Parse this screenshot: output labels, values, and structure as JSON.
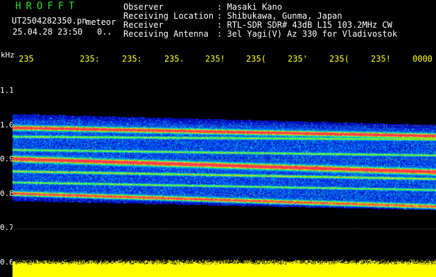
{
  "header": {
    "app_title": "HROFFT",
    "filename": "UT2504282350.pn",
    "type_label": "meteor",
    "datetime": "25.04.28 23:50",
    "dots": "0..",
    "info": [
      {
        "label": "Observer",
        "sep": ":",
        "value": "Masaki Kano"
      },
      {
        "label": "Receiving Location",
        "sep": ":",
        "value": "Shibukawa, Gunma, Japan"
      },
      {
        "label": "Receiver",
        "sep": ":",
        "value": "RTL-SDR SDR# 43dB L15 103.2MHz CW"
      },
      {
        "label": "Receiving Antenna",
        "sep": ":",
        "value": "3el Yagi(V) Az 330 for Vladivostok"
      }
    ]
  },
  "axis": {
    "unit": "kHz",
    "time_ticks": [
      "235",
      "235:",
      "235:",
      "235.",
      "235!",
      "235(",
      "235'",
      "235(",
      "235!",
      "0000"
    ],
    "y_ticks": [
      "1.1",
      "1.0",
      "0.9",
      "0.8",
      "0.7",
      "0.6"
    ]
  },
  "colors": {
    "title": "#22e222",
    "ticks": "#ffff00",
    "text": "#ffffff",
    "background": "#000000"
  }
}
